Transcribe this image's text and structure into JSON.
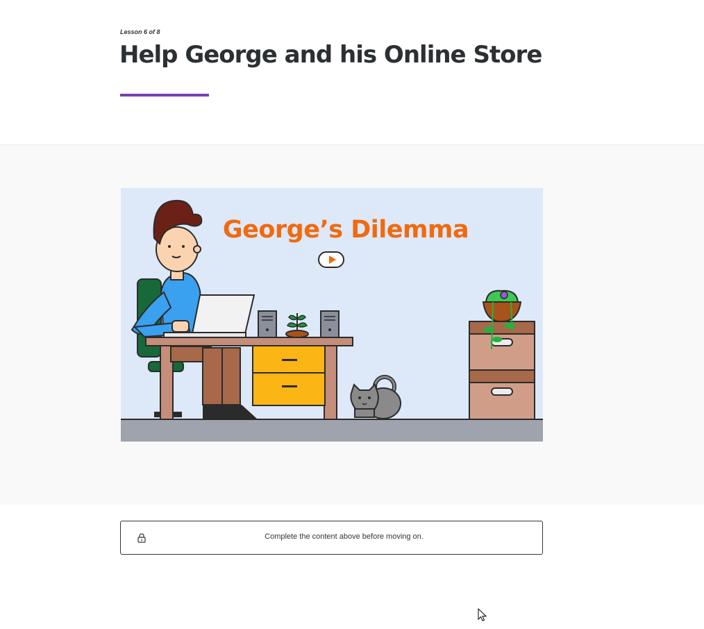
{
  "lesson": {
    "counter": "Lesson 6 of 8",
    "title": "Help George and his Online Store"
  },
  "video": {
    "title": "George’s Dilemma",
    "play_icon": "play-icon"
  },
  "notice": {
    "icon": "lock-icon",
    "text": "Complete the content above before moving on."
  },
  "colors": {
    "accent": "#7a3fb5",
    "video_title": "#f06a0f",
    "video_background": "#dde8f8"
  }
}
